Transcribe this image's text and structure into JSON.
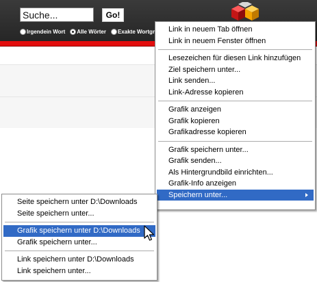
{
  "search": {
    "value": "Suche...",
    "button_label": "Go!",
    "options": [
      "Irgendein Wort",
      "Alle Wörter",
      "Exakte Wortgr"
    ],
    "selected_option": 1
  },
  "colors": {
    "topbar": "#2e2e2e",
    "stripe": "#e20d0d",
    "highlight": "#316ac5",
    "logo": [
      "#d21c1c",
      "#f5a500",
      "#b0b0b0"
    ]
  },
  "icons": {
    "logo": "cube-logo-icon",
    "submenu": "triangle-right-icon",
    "cursor": "mouse-pointer-icon"
  },
  "context_menu": {
    "groups": [
      [
        "Link in neuem Tab öffnen",
        "Link in neuem Fenster öffnen"
      ],
      [
        "Lesezeichen für diesen Link hinzufügen",
        "Ziel speichern unter...",
        "Link senden...",
        "Link-Adresse kopieren"
      ],
      [
        "Grafik anzeigen",
        "Grafik kopieren",
        "Grafikadresse kopieren"
      ],
      [
        "Grafik speichern unter...",
        "Grafik senden...",
        "Als Hintergrundbild einrichten...",
        "Grafik-Info anzeigen",
        "Speichern unter..."
      ]
    ],
    "highlighted": "Speichern unter..."
  },
  "submenu": {
    "groups": [
      [
        "Seite speichern unter D:\\Downloads",
        "Seite speichern unter..."
      ],
      [
        "Grafik speichern unter D:\\Downloads",
        "Grafik speichern unter..."
      ],
      [
        "Link speichern unter D:\\Downloads",
        "Link speichern unter..."
      ]
    ],
    "highlighted": "Grafik speichern unter D:\\Downloads"
  }
}
